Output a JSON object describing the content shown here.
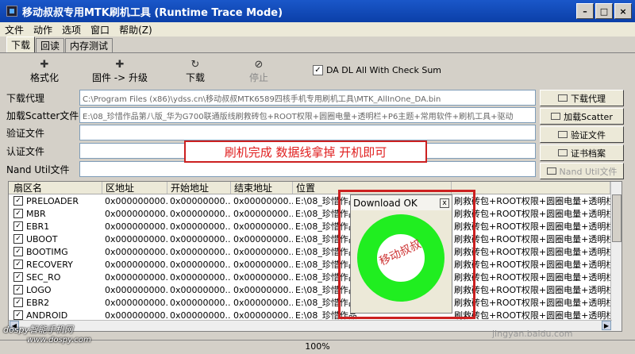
{
  "window": {
    "title": "移动叔叔专用MTK刷机工具 (Runtime Trace Mode)",
    "minimize": "–",
    "maximize": "□",
    "close": "×"
  },
  "menu": [
    "文件",
    "动作",
    "选项",
    "窗口",
    "帮助(Z)"
  ],
  "tabs": [
    "下载",
    "回读",
    "内存测试"
  ],
  "toolbar": {
    "format": "格式化",
    "upgrade": "固件 -> 升级",
    "download": "下载",
    "stop": "停止",
    "checkbox_label": "DA DL All With Check Sum"
  },
  "form": {
    "download_agent_label": "下载代理",
    "download_agent_value": "C:\\Program Files (x86)\\ydss.cn\\移动叔叔MTK6589四核手机专用刷机工具\\MTK_AllInOne_DA.bin",
    "scatter_label": "加载Scatter文件",
    "scatter_value": "E:\\08_珍惜作品第八版_华为G700联通版线刷救砖包+ROOT权限+圆圈电量+透明栏+P6主题+常用软件+刷机工具+驱动",
    "auth_label": "验证文件",
    "cert_label": "认证文件",
    "nand_label": "Nand Util文件"
  },
  "side_buttons": {
    "download_agent": "下载代理",
    "load_scatter": "加载Scatter",
    "auth_file": "验证文件",
    "cert_file": "证书档案",
    "nand_util": "Nand Util文件"
  },
  "table": {
    "headers": [
      "扇区名",
      "区地址",
      "开始地址",
      "结束地址",
      "位置",
      ""
    ],
    "rows": [
      {
        "name": "PRELOADER",
        "a": "0x000000000...",
        "b": "0x00000000...",
        "c": "0x00000000...",
        "loc": "E:\\08_珍惜作品",
        "tail": "刷救砖包+ROOT权限+圆圈电量+透明栏"
      },
      {
        "name": "MBR",
        "a": "0x000000000...",
        "b": "0x00000000...",
        "c": "0x00000000...",
        "loc": "E:\\08_珍惜作品",
        "tail": "刷救砖包+ROOT权限+圆圈电量+透明栏"
      },
      {
        "name": "EBR1",
        "a": "0x000000000...",
        "b": "0x00000000...",
        "c": "0x00000000...",
        "loc": "E:\\08_珍惜作品",
        "tail": "刷救砖包+ROOT权限+圆圈电量+透明栏"
      },
      {
        "name": "UBOOT",
        "a": "0x000000000...",
        "b": "0x00000000...",
        "c": "0x00000000...",
        "loc": "E:\\08_珍惜作品",
        "tail": "刷救砖包+ROOT权限+圆圈电量+透明栏"
      },
      {
        "name": "BOOTIMG",
        "a": "0x000000000...",
        "b": "0x00000000...",
        "c": "0x00000000...",
        "loc": "E:\\08_珍惜作品",
        "tail": "刷救砖包+ROOT权限+圆圈电量+透明栏"
      },
      {
        "name": "RECOVERY",
        "a": "0x000000000...",
        "b": "0x00000000...",
        "c": "0x00000000...",
        "loc": "E:\\08_珍惜作品",
        "tail": "刷救砖包+ROOT权限+圆圈电量+透明栏"
      },
      {
        "name": "SEC_RO",
        "a": "0x000000000...",
        "b": "0x00000000...",
        "c": "0x00000000...",
        "loc": "E:\\08_珍惜作品",
        "tail": "刷救砖包+ROOT权限+圆圈电量+透明栏"
      },
      {
        "name": "LOGO",
        "a": "0x000000000...",
        "b": "0x00000000...",
        "c": "0x00000000...",
        "loc": "E:\\08_珍惜作品",
        "tail": "刷救砖包+ROOT权限+圆圈电量+透明栏"
      },
      {
        "name": "EBR2",
        "a": "0x000000000...",
        "b": "0x00000000...",
        "c": "0x00000000...",
        "loc": "E:\\08_珍惜作品",
        "tail": "刷救砖包+ROOT权限+圆圈电量+透明栏"
      },
      {
        "name": "ANDROID",
        "a": "0x000000000...",
        "b": "0x00000000...",
        "c": "0x00000000...",
        "loc": "E:\\08_珍惜作品",
        "tail": "刷救砖包+ROOT权限+圆圈电量+透明栏"
      }
    ]
  },
  "status": {
    "zoom": "100%"
  },
  "annotation": {
    "text": "刷机完成   数据线拿掉  开机即可"
  },
  "dialog": {
    "title": "Download OK",
    "close": "x",
    "ring_text": "移动叔叔",
    "ring_color": "#20ee20"
  },
  "watermarks": {
    "left_brand": "dospy智能手机网",
    "left_url": "www.dospy.com",
    "right": "jingyan.baidu.com"
  }
}
